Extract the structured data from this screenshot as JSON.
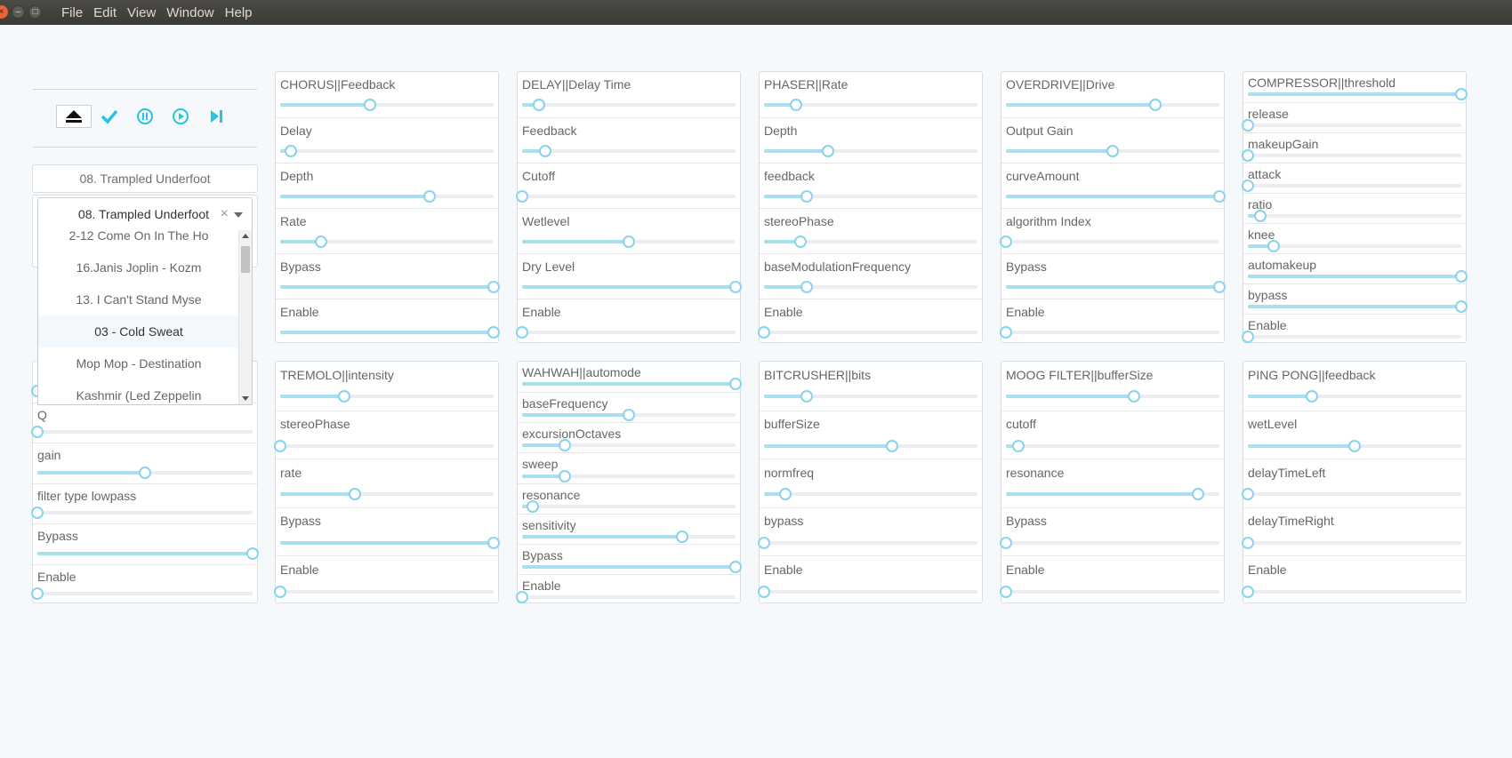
{
  "menu": [
    "File",
    "Edit",
    "View",
    "Window",
    "Help"
  ],
  "window_buttons": {
    "close": "×",
    "min": "–",
    "max": "□"
  },
  "transport": {
    "icons": [
      "eject-icon",
      "check-icon",
      "pause-icon",
      "play-icon",
      "skip-forward-icon"
    ],
    "color": "#28c3df"
  },
  "current_track": "08. Trampled Underfoot",
  "select": {
    "value": "08. Trampled Underfoot",
    "clear": "×",
    "options": [
      {
        "label": "2-12 Come On In The Ho",
        "highlighted": false
      },
      {
        "label": "16.Janis Joplin - Kozm",
        "highlighted": false
      },
      {
        "label": "13. I Can't Stand Myse",
        "highlighted": false
      },
      {
        "label": "03 - Cold Sweat",
        "highlighted": true
      },
      {
        "label": "Mop Mop - Destination",
        "highlighted": false
      },
      {
        "label": "Kashmir (Led Zeppelin",
        "highlighted": false
      }
    ]
  },
  "filter_card": {
    "controls": [
      {
        "label": "",
        "value": 0.0
      },
      {
        "label": "Q",
        "value": 0.0
      },
      {
        "label": "gain",
        "value": 0.5
      },
      {
        "label": "filter type lowpass",
        "value": 0.0
      },
      {
        "label": "Bypass",
        "value": 1.0
      },
      {
        "label": "Enable",
        "value": 0.0
      }
    ]
  },
  "effects": [
    {
      "controls": [
        {
          "label": "CHORUS||Feedback",
          "value": 0.42
        },
        {
          "label": "Delay",
          "value": 0.05
        },
        {
          "label": "Depth",
          "value": 0.7
        },
        {
          "label": "Rate",
          "value": 0.19
        },
        {
          "label": "Bypass",
          "value": 1.0
        },
        {
          "label": "Enable",
          "value": 1.0
        }
      ]
    },
    {
      "controls": [
        {
          "label": "DELAY||Delay Time",
          "value": 0.08
        },
        {
          "label": "Feedback",
          "value": 0.11
        },
        {
          "label": "Cutoff",
          "value": 0.0
        },
        {
          "label": "Wetlevel",
          "value": 0.5
        },
        {
          "label": "Dry Level",
          "value": 1.0
        },
        {
          "label": "Enable",
          "value": 0.0
        }
      ]
    },
    {
      "controls": [
        {
          "label": "PHASER||Rate",
          "value": 0.15
        },
        {
          "label": "Depth",
          "value": 0.3
        },
        {
          "label": "feedback",
          "value": 0.2
        },
        {
          "label": "stereoPhase",
          "value": 0.17
        },
        {
          "label": "baseModulationFrequency",
          "value": 0.2
        },
        {
          "label": "Enable",
          "value": 0.0
        }
      ]
    },
    {
      "controls": [
        {
          "label": "OVERDRIVE||Drive",
          "value": 0.7
        },
        {
          "label": "Output Gain",
          "value": 0.5
        },
        {
          "label": "curveAmount",
          "value": 1.0
        },
        {
          "label": "algorithm Index",
          "value": 0.0
        },
        {
          "label": "Bypass",
          "value": 1.0
        },
        {
          "label": "Enable",
          "value": 0.0
        }
      ]
    },
    {
      "controls": [
        {
          "label": "COMPRESSOR||threshold",
          "value": 1.0
        },
        {
          "label": "release",
          "value": 0.0
        },
        {
          "label": "makeupGain",
          "value": 0.0
        },
        {
          "label": "attack",
          "value": 0.0
        },
        {
          "label": "ratio",
          "value": 0.06
        },
        {
          "label": "knee",
          "value": 0.12
        },
        {
          "label": "automakeup",
          "value": 1.0
        },
        {
          "label": "bypass",
          "value": 1.0
        },
        {
          "label": "Enable",
          "value": 0.0
        }
      ]
    },
    {
      "controls": [
        {
          "label": "TREMOLO||intensity",
          "value": 0.3
        },
        {
          "label": "stereoPhase",
          "value": 0.0
        },
        {
          "label": "rate",
          "value": 0.35
        },
        {
          "label": "Bypass",
          "value": 1.0
        },
        {
          "label": "Enable",
          "value": 0.0
        }
      ]
    },
    {
      "controls": [
        {
          "label": "WAHWAH||automode",
          "value": 1.0
        },
        {
          "label": "baseFrequency",
          "value": 0.5
        },
        {
          "label": "excursionOctaves",
          "value": 0.2
        },
        {
          "label": "sweep",
          "value": 0.2
        },
        {
          "label": "resonance",
          "value": 0.05
        },
        {
          "label": "sensitivity",
          "value": 0.75
        },
        {
          "label": "Bypass",
          "value": 1.0
        },
        {
          "label": "Enable",
          "value": 0.0
        }
      ]
    },
    {
      "controls": [
        {
          "label": "BITCRUSHER||bits",
          "value": 0.2
        },
        {
          "label": "bufferSize",
          "value": 0.6
        },
        {
          "label": "normfreq",
          "value": 0.1
        },
        {
          "label": "bypass",
          "value": 0.0
        },
        {
          "label": "Enable",
          "value": 0.0
        }
      ]
    },
    {
      "controls": [
        {
          "label": "MOOG FILTER||bufferSize",
          "value": 0.6
        },
        {
          "label": "cutoff",
          "value": 0.06
        },
        {
          "label": "resonance",
          "value": 0.9
        },
        {
          "label": "Bypass",
          "value": 0.0
        },
        {
          "label": "Enable",
          "value": 0.0
        }
      ]
    },
    {
      "controls": [
        {
          "label": "PING PONG||feedback",
          "value": 0.3
        },
        {
          "label": "wetLevel",
          "value": 0.5
        },
        {
          "label": "delayTimeLeft",
          "value": 0.0
        },
        {
          "label": "delayTimeRight",
          "value": 0.0
        },
        {
          "label": "Enable",
          "value": 0.0
        }
      ]
    }
  ]
}
